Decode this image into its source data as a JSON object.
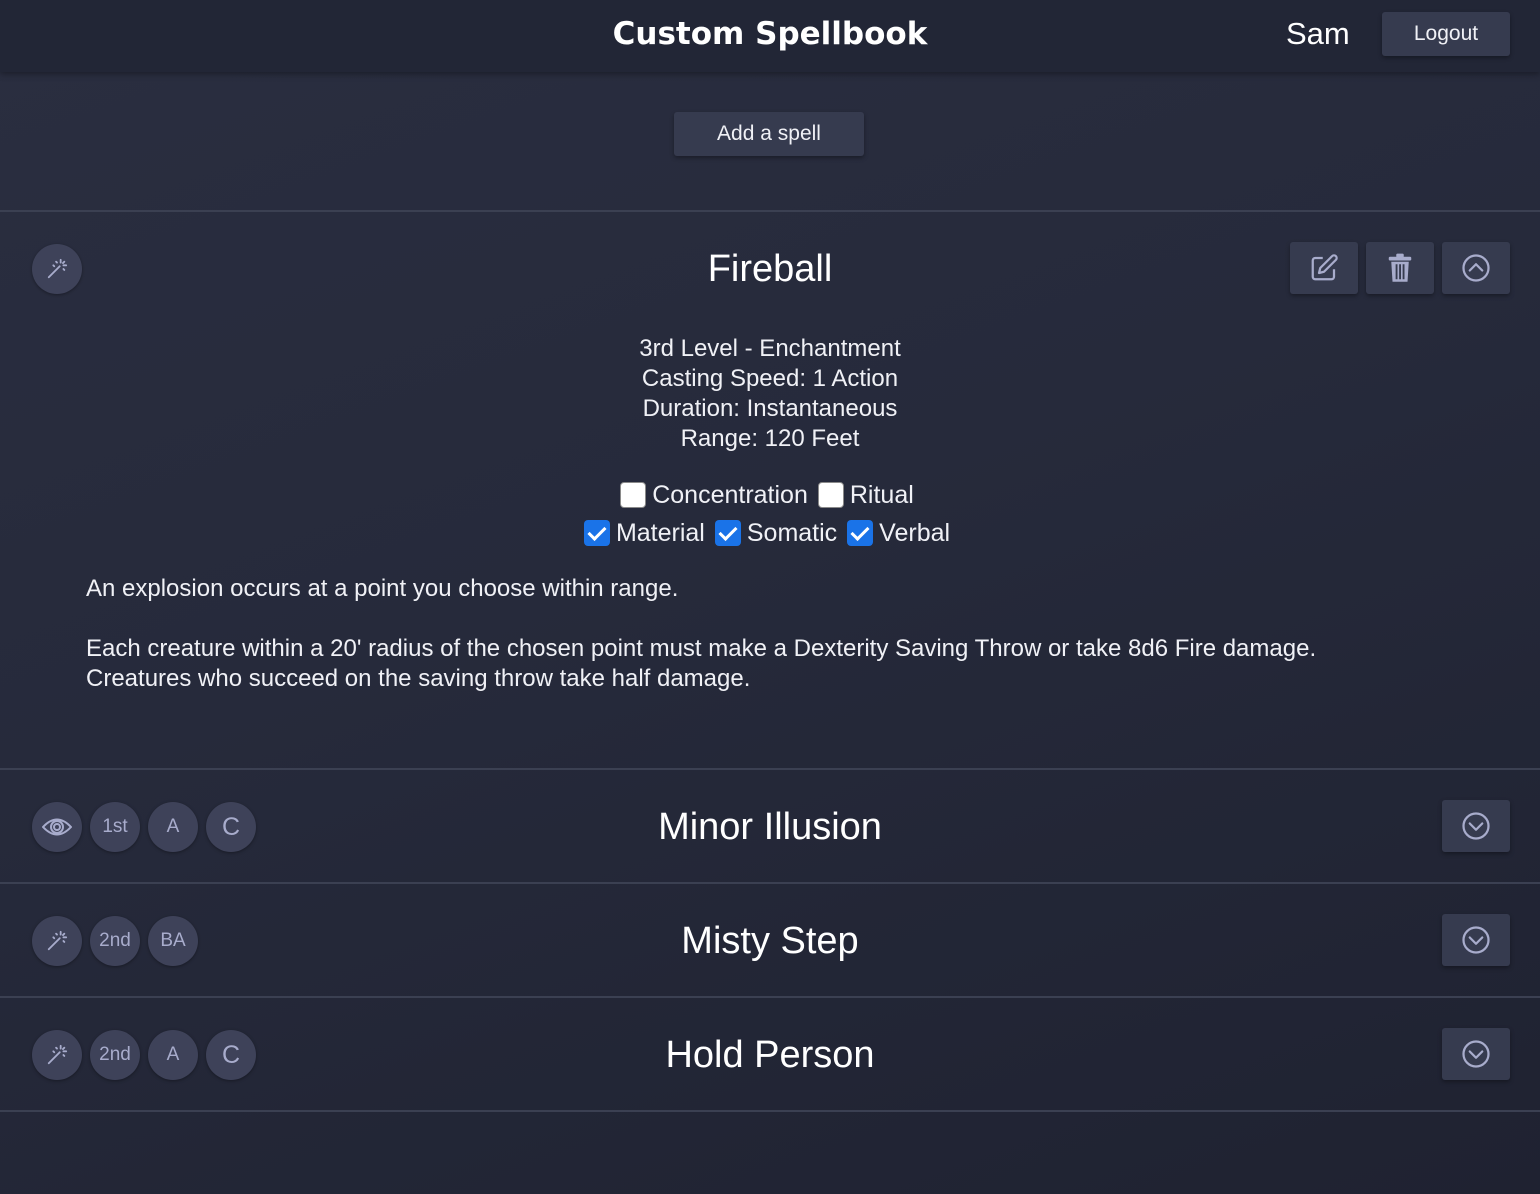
{
  "header": {
    "title": "Custom Spellbook",
    "username": "Sam",
    "logout_label": "Logout"
  },
  "actions": {
    "add_spell_label": "Add a spell"
  },
  "expanded_spell": {
    "name": "Fireball",
    "school_icon": "magic-wand-icon",
    "level_school": "3rd Level - Enchantment",
    "casting_speed": "Casting Speed: 1 Action",
    "duration": "Duration: Instantaneous",
    "range": "Range: 120 Feet",
    "flags": {
      "concentration": {
        "label": "Concentration",
        "checked": false
      },
      "ritual": {
        "label": "Ritual",
        "checked": false
      },
      "material": {
        "label": "Material",
        "checked": true
      },
      "somatic": {
        "label": "Somatic",
        "checked": true
      },
      "verbal": {
        "label": "Verbal",
        "checked": true
      }
    },
    "description_1": "An explosion occurs at a point you choose within range.",
    "description_2": "Each creature within a 20' radius of the chosen point must make a Dexterity Saving Throw or take 8d6 Fire damage.\nCreatures who succeed on the saving throw take half damage.",
    "buttons": [
      "edit-icon",
      "trash-icon",
      "chevron-up-circle-icon"
    ]
  },
  "spells": [
    {
      "name": "Minor Illusion",
      "school_icon": "eye-icon",
      "level": "1st",
      "cast": "A",
      "concentration": "C"
    },
    {
      "name": "Misty Step",
      "school_icon": "magic-wand-icon",
      "level": "2nd",
      "cast": "BA"
    },
    {
      "name": "Hold Person",
      "school_icon": "magic-wand-icon",
      "level": "2nd",
      "cast": "A",
      "concentration": "C"
    }
  ],
  "colors": {
    "background": "#262a3b",
    "header": "#222636",
    "button": "#363b4f",
    "badge": "#3e4259",
    "badge_text": "#a8accc",
    "checkbox_checked": "#1a73e8"
  }
}
